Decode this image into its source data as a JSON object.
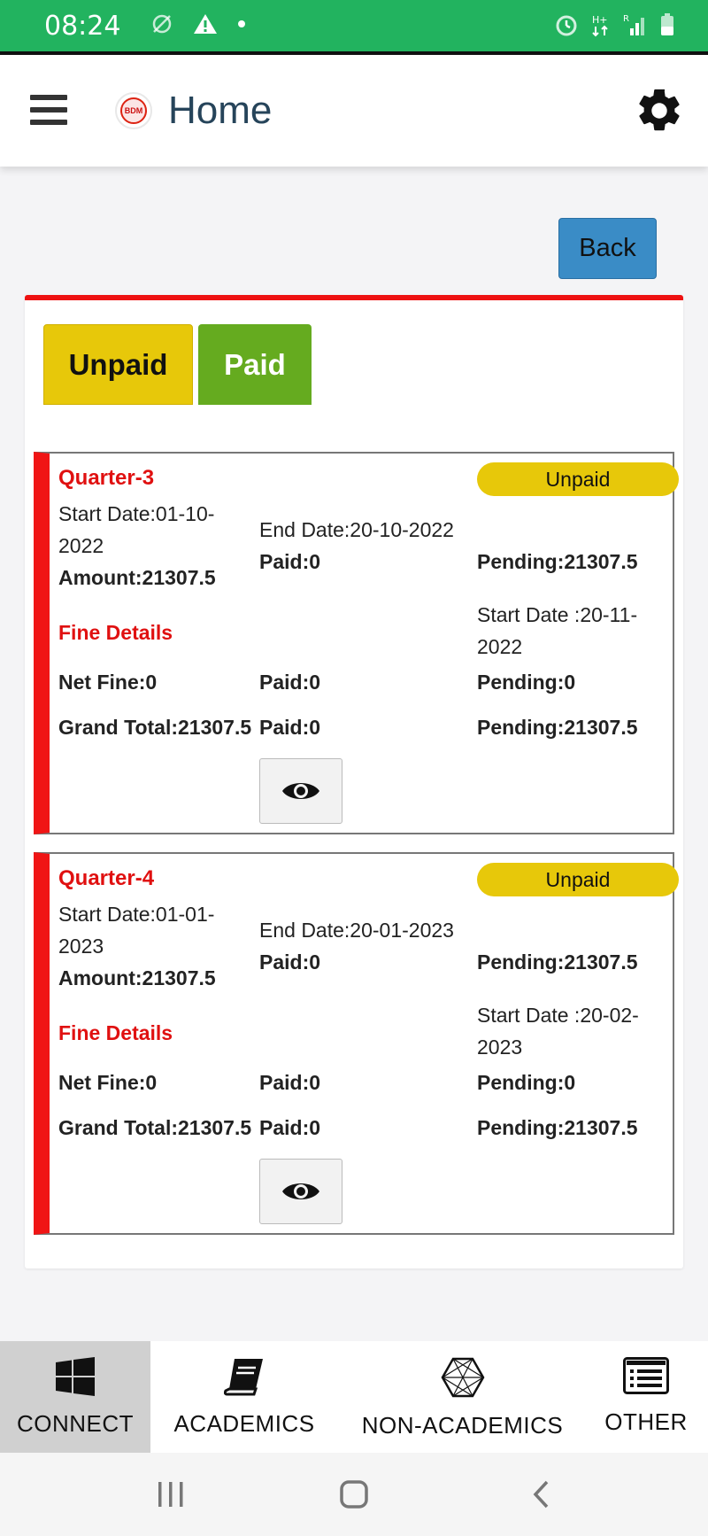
{
  "status_bar": {
    "time": "08:24"
  },
  "app_bar": {
    "title": "Home"
  },
  "back_button": "Back",
  "tabs": [
    {
      "label": "Unpaid"
    },
    {
      "label": "Paid"
    }
  ],
  "quarters": [
    {
      "title": "Quarter-3",
      "status": "Unpaid",
      "start_date": "Start Date:01-10-2022",
      "end_date": "End Date:20-10-2022",
      "amount": "Amount:21307.5",
      "paid": "Paid:0",
      "pending": "Pending:21307.5",
      "fine_title": "Fine Details",
      "fine_start_date": "Start Date :20-11-2022",
      "net_fine": "Net Fine:0",
      "fine_paid": "Paid:0",
      "fine_pending": "Pending:0",
      "grand_total": "Grand Total:21307.5",
      "total_paid": "Paid:0",
      "total_pending": "Pending:21307.5"
    },
    {
      "title": "Quarter-4",
      "status": "Unpaid",
      "start_date": "Start Date:01-01-2023",
      "end_date": "End Date:20-01-2023",
      "amount": "Amount:21307.5",
      "paid": "Paid:0",
      "pending": "Pending:21307.5",
      "fine_title": "Fine Details",
      "fine_start_date": "Start Date :20-02-2023",
      "net_fine": "Net Fine:0",
      "fine_paid": "Paid:0",
      "fine_pending": "Pending:0",
      "grand_total": "Grand Total:21307.5",
      "total_paid": "Paid:0",
      "total_pending": "Pending:21307.5"
    }
  ],
  "bottom_nav": [
    {
      "label": "CONNECT",
      "icon": "windows-icon",
      "active": true
    },
    {
      "label": "ACADEMICS",
      "icon": "book-icon",
      "active": false
    },
    {
      "label": "NON-ACADEMICS",
      "icon": "network-icon",
      "active": false
    },
    {
      "label": "OTHER",
      "icon": "list-icon",
      "active": false
    }
  ],
  "colors": {
    "status_bar": "#22b35f",
    "accent_red": "#e01010",
    "unpaid_yellow": "#e7c80a",
    "paid_green": "#65ab1f",
    "back_blue": "#3a8cc6"
  }
}
